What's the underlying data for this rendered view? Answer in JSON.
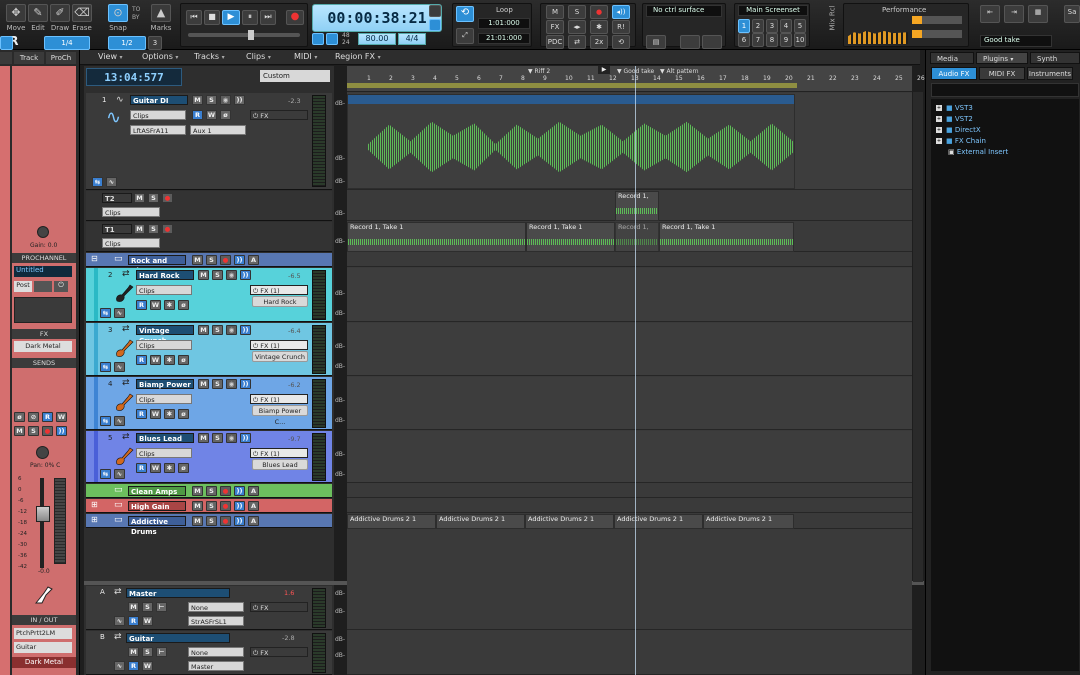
{
  "tools": [
    {
      "label": "Move",
      "icon": "move-icon"
    },
    {
      "label": "Edit",
      "icon": "edit-icon"
    },
    {
      "label": "Draw",
      "icon": "draw-icon"
    },
    {
      "label": "Erase",
      "icon": "erase-icon"
    },
    {
      "label": "Snap",
      "icon": "snap-icon"
    },
    {
      "label": "Marks",
      "icon": "marks-icon"
    }
  ],
  "snap": {
    "value": "1/2",
    "resolution": "1/4",
    "extra": "3",
    "to": "TO",
    "by": "BY"
  },
  "transport": {
    "time": "00:00:38:21",
    "bpm": "80.00",
    "meter": "4/4",
    "bpm_hint": "48\n24",
    "loop_label": "Loop",
    "loop_start": "1:01:000",
    "loop_end": "21:01:000"
  },
  "mix": {
    "fx": "FX",
    "pdc": "PDC",
    "ri": "R!",
    "twox": "2x"
  },
  "control_surface": "No ctrl surface",
  "screensets": {
    "label": "Main Screenset",
    "numbers": [
      "1",
      "2",
      "3",
      "4",
      "5",
      "6",
      "7",
      "8",
      "9",
      "10"
    ]
  },
  "performance": {
    "label": "Performance",
    "pct1": "0%",
    "pct2": "0%"
  },
  "mix_rcl": "Mix Rcl",
  "good_take": "Good take",
  "brand": "AR",
  "inspector": {
    "tabs": [
      "Track",
      "ProCh"
    ],
    "gain": "Gain: 0.0",
    "prochannel": "PROCHANNEL",
    "untitled": "Untitled",
    "post": "Post",
    "fx": "FX",
    "fx_item": "Dark Metal",
    "sends": "SENDS",
    "pan": "Pan: 0% C",
    "fader_val": "-0.0",
    "in_out": "IN / OUT",
    "input": "PtchPrtt2LM",
    "output": "Guitar",
    "bottom_name": "Dark Metal",
    "scale": [
      "6",
      "0",
      "-6",
      "-12",
      "-18",
      "-24",
      "-30",
      "-36",
      "-42"
    ]
  },
  "menu": [
    "View",
    "Options",
    "Tracks",
    "Clips",
    "MIDI",
    "Region FX"
  ],
  "now_time": "13:04:577",
  "custom": "Custom",
  "ruler": {
    "ticks": [
      "1",
      "2",
      "3",
      "4",
      "5",
      "6",
      "7",
      "8",
      "9",
      "10",
      "11",
      "12",
      "13",
      "14",
      "15",
      "16",
      "17",
      "18",
      "19",
      "20",
      "21",
      "22",
      "23",
      "24",
      "25",
      "26"
    ],
    "markers": [
      "Riff 2",
      "Good take",
      "Alt pattern"
    ]
  },
  "tracks": {
    "guitar_di": {
      "num": "1",
      "name": "Guitar DI",
      "vol": "-2.3",
      "clips": "Clips",
      "input": "LftASFrA11",
      "output": "Aux 1",
      "fx": "FX"
    },
    "t2": {
      "label": "T2",
      "clips": "Clips"
    },
    "t1": {
      "label": "T1",
      "clips": "Clips"
    },
    "rock_blues": {
      "name": "Rock and Blues"
    },
    "hard_rock": {
      "num": "2",
      "name": "Hard Rock",
      "vol": "-6.5",
      "clips": "Clips",
      "fx": "FX (1)",
      "plugin": "Hard Rock"
    },
    "vintage": {
      "num": "3",
      "name": "Vintage Crunch",
      "vol": "-6.4",
      "clips": "Clips",
      "fx": "FX (1)",
      "plugin": "Vintage Crunch"
    },
    "biamp": {
      "num": "4",
      "name": "Biamp Power",
      "vol": "-6.2",
      "clips": "Clips",
      "fx": "FX (1)",
      "plugin": "Biamp Power C..."
    },
    "blues_lead": {
      "num": "5",
      "name": "Blues Lead",
      "vol": "-9.7",
      "clips": "Clips",
      "fx": "FX (1)",
      "plugin": "Blues Lead"
    },
    "clean_amps": {
      "name": "Clean Amps"
    },
    "high_gain": {
      "name": "High Gain"
    },
    "addictive": {
      "name": "Addictive Drums"
    },
    "master": {
      "letter": "A",
      "name": "Master",
      "vol": "1.6",
      "out": "None",
      "fx": "FX",
      "input": "StrASFrSL1"
    },
    "guitar_bus": {
      "letter": "B",
      "name": "Guitar",
      "vol": "-2.8",
      "out": "None",
      "fx": "FX",
      "input": "Master"
    }
  },
  "clips": {
    "t2_take": "Record 1,",
    "t1_take": "Record 1, Take 1",
    "t1_take_b": "Record 1, Take 1",
    "t1_take_c": "Record 1,",
    "t1_take_d": "Record 1, Take 1",
    "drums": [
      "Addictive Drums 2 1",
      "Addictive Drums 2 1",
      "Addictive Drums 2 1",
      "Addictive Drums 2 1",
      "Addictive Drums 2 1"
    ],
    "db": "dB-"
  },
  "browser": {
    "tabs": [
      "Media",
      "Plugins",
      "Synth"
    ],
    "subtabs": [
      "Audio FX",
      "MIDI FX",
      "Instruments"
    ],
    "tree": [
      "VST3",
      "VST2",
      "DirectX",
      "FX Chain",
      "External Insert"
    ]
  },
  "colors": {
    "accent": "#2d8fd6",
    "inspector_red": "#cf6e6e",
    "rock_cyan": "#57d2da",
    "vintage_cyan": "#6fc6e2",
    "biamp_blue": "#6ea6e6",
    "blues_blue": "#7084e6",
    "clean_green": "#6cbf5e",
    "highgain_red": "#d36565",
    "wave_green": "#5dbb57"
  }
}
